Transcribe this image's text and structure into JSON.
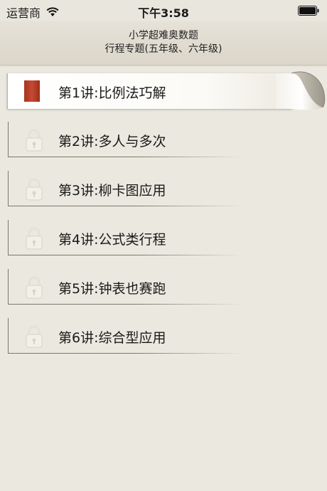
{
  "status_bar": {
    "carrier": "运营商",
    "time": "下午3:58",
    "wifi_icon": "wifi-icon",
    "battery_icon": "battery-icon"
  },
  "nav": {
    "title_line1": "小学超难奥数题",
    "title_line2": "行程专题(五年级、六年级)"
  },
  "lessons": [
    {
      "label": "第1讲:比例法巧解",
      "state": "unlocked",
      "icon": "bookmark-icon",
      "accent": "#b43c26"
    },
    {
      "label": "第2讲:多人与多次",
      "state": "locked",
      "icon": "lock-icon"
    },
    {
      "label": "第3讲:柳卡图应用",
      "state": "locked",
      "icon": "lock-icon"
    },
    {
      "label": "第4讲:公式类行程",
      "state": "locked",
      "icon": "lock-icon"
    },
    {
      "label": "第5讲:钟表也赛跑",
      "state": "locked",
      "icon": "lock-icon"
    },
    {
      "label": "第6讲:综合型应用",
      "state": "locked",
      "icon": "lock-icon"
    }
  ]
}
